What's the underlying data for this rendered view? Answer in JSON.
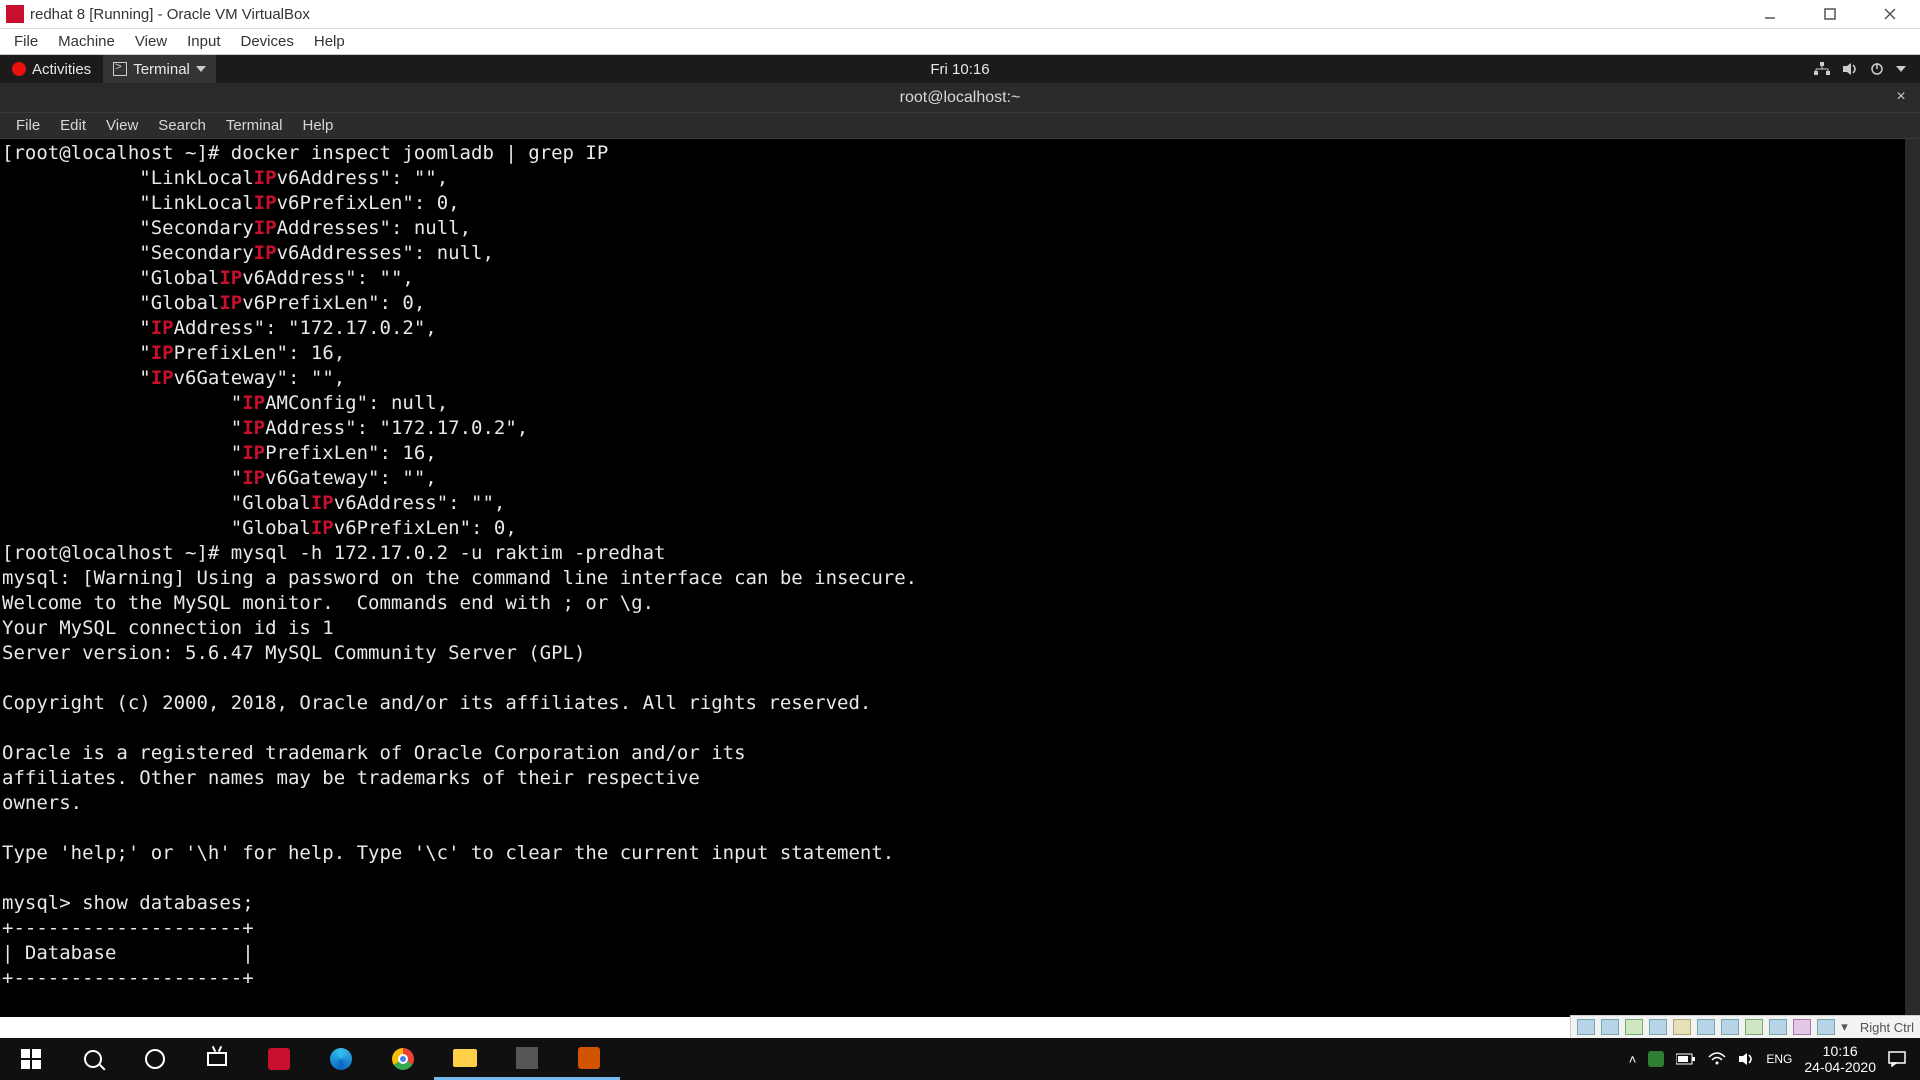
{
  "virtualbox": {
    "window_title": "redhat 8 [Running] - Oracle VM VirtualBox",
    "menu": [
      "File",
      "Machine",
      "View",
      "Input",
      "Devices",
      "Help"
    ],
    "status_hostkey": "Right Ctrl"
  },
  "gnome": {
    "activities_label": "Activities",
    "app_label": "Terminal",
    "clock": "Fri 10:16",
    "window_title": "root@localhost:~"
  },
  "terminal_menu": [
    "File",
    "Edit",
    "View",
    "Search",
    "Terminal",
    "Help"
  ],
  "terminal": {
    "prompt1": "[root@localhost ~]# ",
    "cmd1": "docker inspect joomladb | grep IP",
    "ip_lines": [
      {
        "indent": "            ",
        "pre": "\"LinkLocal",
        "mid": "IP",
        "post": "v6Address\": \"\","
      },
      {
        "indent": "            ",
        "pre": "\"LinkLocal",
        "mid": "IP",
        "post": "v6PrefixLen\": 0,"
      },
      {
        "indent": "            ",
        "pre": "\"Secondary",
        "mid": "IP",
        "post": "Addresses\": null,"
      },
      {
        "indent": "            ",
        "pre": "\"Secondary",
        "mid": "IP",
        "post": "v6Addresses\": null,"
      },
      {
        "indent": "            ",
        "pre": "\"Global",
        "mid": "IP",
        "post": "v6Address\": \"\","
      },
      {
        "indent": "            ",
        "pre": "\"Global",
        "mid": "IP",
        "post": "v6PrefixLen\": 0,"
      },
      {
        "indent": "            ",
        "pre": "\"",
        "mid": "IP",
        "post": "Address\": \"172.17.0.2\","
      },
      {
        "indent": "            ",
        "pre": "\"",
        "mid": "IP",
        "post": "PrefixLen\": 16,"
      },
      {
        "indent": "            ",
        "pre": "\"",
        "mid": "IP",
        "post": "v6Gateway\": \"\","
      },
      {
        "indent": "                    ",
        "pre": "\"",
        "mid": "IP",
        "post": "AMConfig\": null,"
      },
      {
        "indent": "                    ",
        "pre": "\"",
        "mid": "IP",
        "post": "Address\": \"172.17.0.2\","
      },
      {
        "indent": "                    ",
        "pre": "\"",
        "mid": "IP",
        "post": "PrefixLen\": 16,"
      },
      {
        "indent": "                    ",
        "pre": "\"",
        "mid": "IP",
        "post": "v6Gateway\": \"\","
      },
      {
        "indent": "                    ",
        "pre": "\"Global",
        "mid": "IP",
        "post": "v6Address\": \"\","
      },
      {
        "indent": "                    ",
        "pre": "\"Global",
        "mid": "IP",
        "post": "v6PrefixLen\": 0,"
      }
    ],
    "prompt2": "[root@localhost ~]# ",
    "cmd2": "mysql -h 172.17.0.2 -u raktim -predhat",
    "mysql_out": "mysql: [Warning] Using a password on the command line interface can be insecure.\nWelcome to the MySQL monitor.  Commands end with ; or \\g.\nYour MySQL connection id is 1\nServer version: 5.6.47 MySQL Community Server (GPL)\n\nCopyright (c) 2000, 2018, Oracle and/or its affiliates. All rights reserved.\n\nOracle is a registered trademark of Oracle Corporation and/or its\naffiliates. Other names may be trademarks of their respective\nowners.\n\nType 'help;' or '\\h' for help. Type '\\c' to clear the current input statement.\n",
    "mysql_prompt": "mysql> ",
    "mysql_cmd": "show databases;",
    "mysql_table": "+--------------------+\n| Database           |\n+--------------------+"
  },
  "windows": {
    "time": "10:16",
    "date": "24-04-2020"
  }
}
